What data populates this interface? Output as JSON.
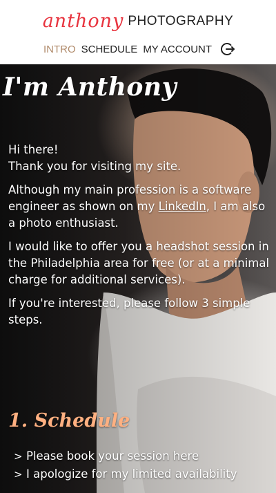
{
  "brand": {
    "script": "anthony",
    "word": "PHOTOGRAPHY"
  },
  "nav": {
    "items": [
      {
        "label": "INTRO",
        "active": true
      },
      {
        "label": "SCHEDULE",
        "active": false
      },
      {
        "label": "MY ACCOUNT",
        "active": false
      }
    ],
    "logout_icon": "logout-icon"
  },
  "hero": {
    "title": "I'm Anthony",
    "greeting": "Hi there!",
    "thanks": "Thank you for visiting my site.",
    "para1_before": "Although my main profession is a software engineer as shown on my ",
    "para1_link": "LinkedIn",
    "para1_after": ", I am also a photo enthusiast.",
    "para2": "I would like to offer you a headshot session in the Philadelphia area for free (or at a minimal charge for additional services).",
    "para3": "If you're interested, please follow 3 simple steps."
  },
  "step1": {
    "title": "1. Schedule",
    "items": [
      {
        "chevron": ">",
        "text": "Please book your session here"
      },
      {
        "chevron": ">",
        "text": "I apologize for my limited availability"
      }
    ]
  },
  "colors": {
    "brand_script": "#e8343f",
    "nav_active": "#b08a6a",
    "step_title": "#ffb081"
  }
}
